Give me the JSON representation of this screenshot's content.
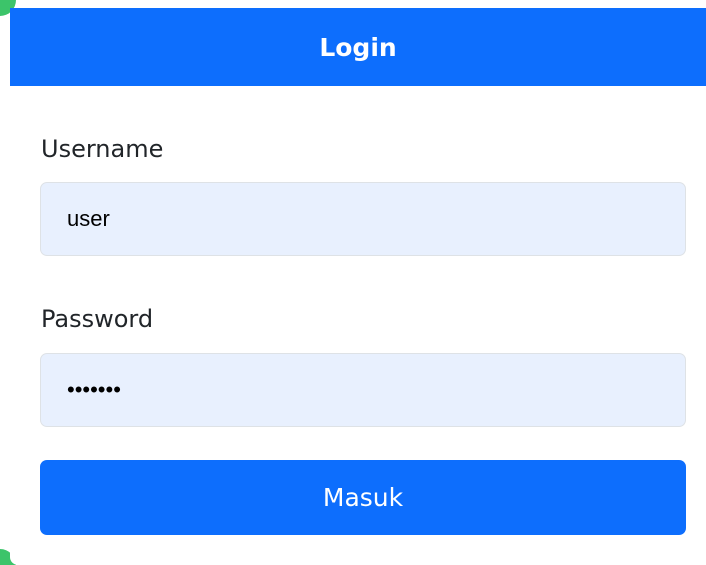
{
  "login": {
    "title": "Login",
    "username_label": "Username",
    "username_value": "user",
    "password_label": "Password",
    "password_value": "1234567",
    "submit_label": "Masuk"
  },
  "colors": {
    "primary": "#0d6efd",
    "input_background": "#e8f0fe",
    "accent_green": "#3cc46a"
  }
}
